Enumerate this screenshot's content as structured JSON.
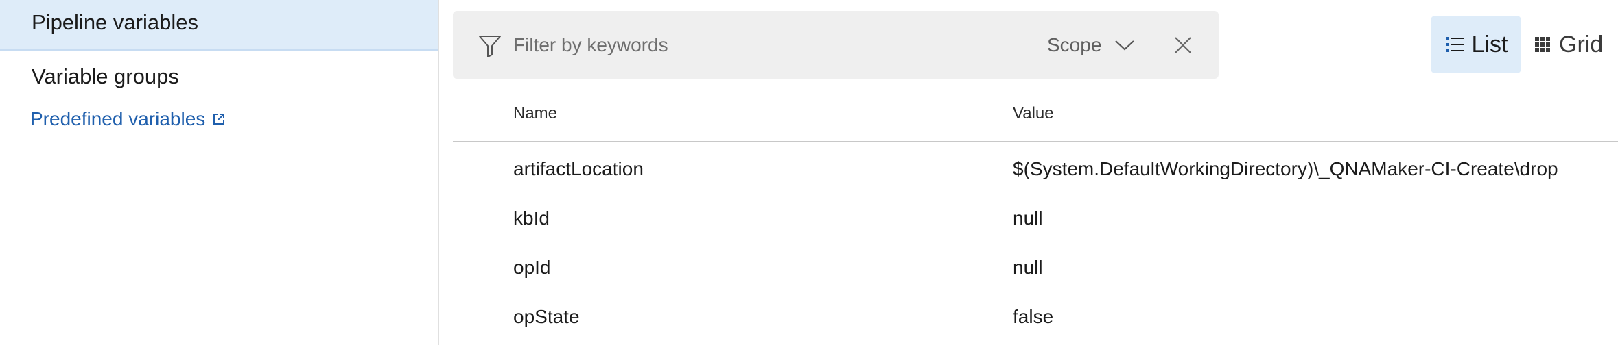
{
  "sidebar": {
    "items": [
      {
        "label": "Pipeline variables",
        "selected": true
      },
      {
        "label": "Variable groups",
        "selected": false
      }
    ],
    "link": {
      "label": "Predefined variables",
      "icon": "external-link-icon"
    }
  },
  "filter": {
    "placeholder": "Filter by keywords",
    "value": "",
    "scope_label": "Scope",
    "icons": {
      "filter": "filter-icon",
      "dropdown": "chevron-down-icon",
      "clear": "close-icon"
    }
  },
  "view": {
    "list_label": "List",
    "grid_label": "Grid",
    "active": "List"
  },
  "table": {
    "columns": [
      "Name",
      "Value"
    ],
    "rows": [
      {
        "name": "artifactLocation",
        "value": "$(System.DefaultWorkingDirectory)\\_QNAMaker-CI-Create\\drop"
      },
      {
        "name": "kbId",
        "value": "null"
      },
      {
        "name": "opId",
        "value": "null"
      },
      {
        "name": "opState",
        "value": "false"
      }
    ]
  },
  "colors": {
    "selected_bg": "#deecf9",
    "link": "#1f5fad",
    "filter_bg": "#efefef"
  }
}
